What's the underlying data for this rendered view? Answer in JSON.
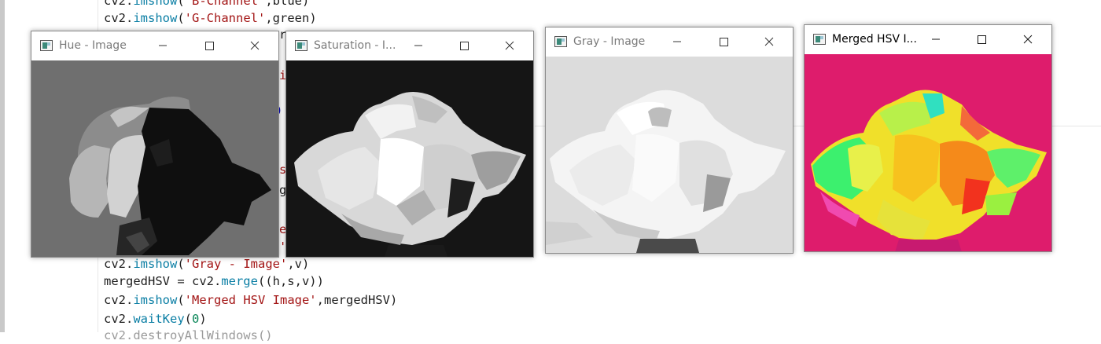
{
  "editor": {
    "lines": [
      {
        "parts": [
          {
            "t": "cv2.",
            "c": ""
          },
          {
            "t": "imshow",
            "c": "fn"
          },
          {
            "t": "(",
            "c": ""
          },
          {
            "t": "'B-Channel'",
            "c": "str"
          },
          {
            "t": ",blue)",
            "c": ""
          }
        ]
      },
      {
        "parts": [
          {
            "t": "cv2.",
            "c": ""
          },
          {
            "t": "imshow",
            "c": "fn"
          },
          {
            "t": "(",
            "c": ""
          },
          {
            "t": "'G-Channel'",
            "c": "str"
          },
          {
            "t": ",green)",
            "c": ""
          }
        ]
      },
      {
        "parts": [
          {
            "t": "cv2.",
            "c": ""
          },
          {
            "t": "imshow",
            "c": "fn"
          },
          {
            "t": "(",
            "c": ""
          },
          {
            "t": "'Gray - Image'",
            "c": "str"
          },
          {
            "t": ",v)",
            "c": ""
          }
        ]
      },
      {
        "parts": [
          {
            "t": "mergedHSV = cv2.",
            "c": ""
          },
          {
            "t": "merge",
            "c": "fn"
          },
          {
            "t": "((h,s,v))",
            "c": ""
          }
        ]
      },
      {
        "parts": [
          {
            "t": "cv2.",
            "c": ""
          },
          {
            "t": "imshow",
            "c": "fn"
          },
          {
            "t": "(",
            "c": ""
          },
          {
            "t": "'Merged HSV Image'",
            "c": "str"
          },
          {
            "t": ",mergedHSV)",
            "c": ""
          }
        ]
      },
      {
        "parts": [
          {
            "t": "cv2.",
            "c": ""
          },
          {
            "t": "waitKey",
            "c": "fn"
          },
          {
            "t": "(",
            "c": ""
          },
          {
            "t": "0",
            "c": "num"
          },
          {
            "t": ")",
            "c": ""
          }
        ]
      }
    ],
    "peek_fragments": [
      "r",
      "i",
      "se",
      "ge",
      "e'",
      "'",
      "0"
    ]
  },
  "windows": {
    "hue": {
      "title": "Hue - Image",
      "controls": [
        "minimize-icon",
        "maximize-icon",
        "close-icon"
      ]
    },
    "saturation": {
      "title": "Saturation - I...",
      "controls": [
        "minimize-icon",
        "maximize-icon",
        "close-icon"
      ]
    },
    "gray": {
      "title": "Gray - Image",
      "controls": [
        "minimize-icon",
        "maximize-icon",
        "close-icon"
      ]
    },
    "merged": {
      "title": "Merged HSV I...",
      "controls": [
        "minimize-icon",
        "maximize-icon",
        "close-icon"
      ]
    }
  },
  "colors": {
    "string": "#a31515",
    "function": "#0a7ea4",
    "number": "#098658",
    "merged_background": "#de1c6c",
    "hue_background": "#6f6f6f",
    "saturation_background": "#151515",
    "gray_background": "#dcdcdc"
  }
}
